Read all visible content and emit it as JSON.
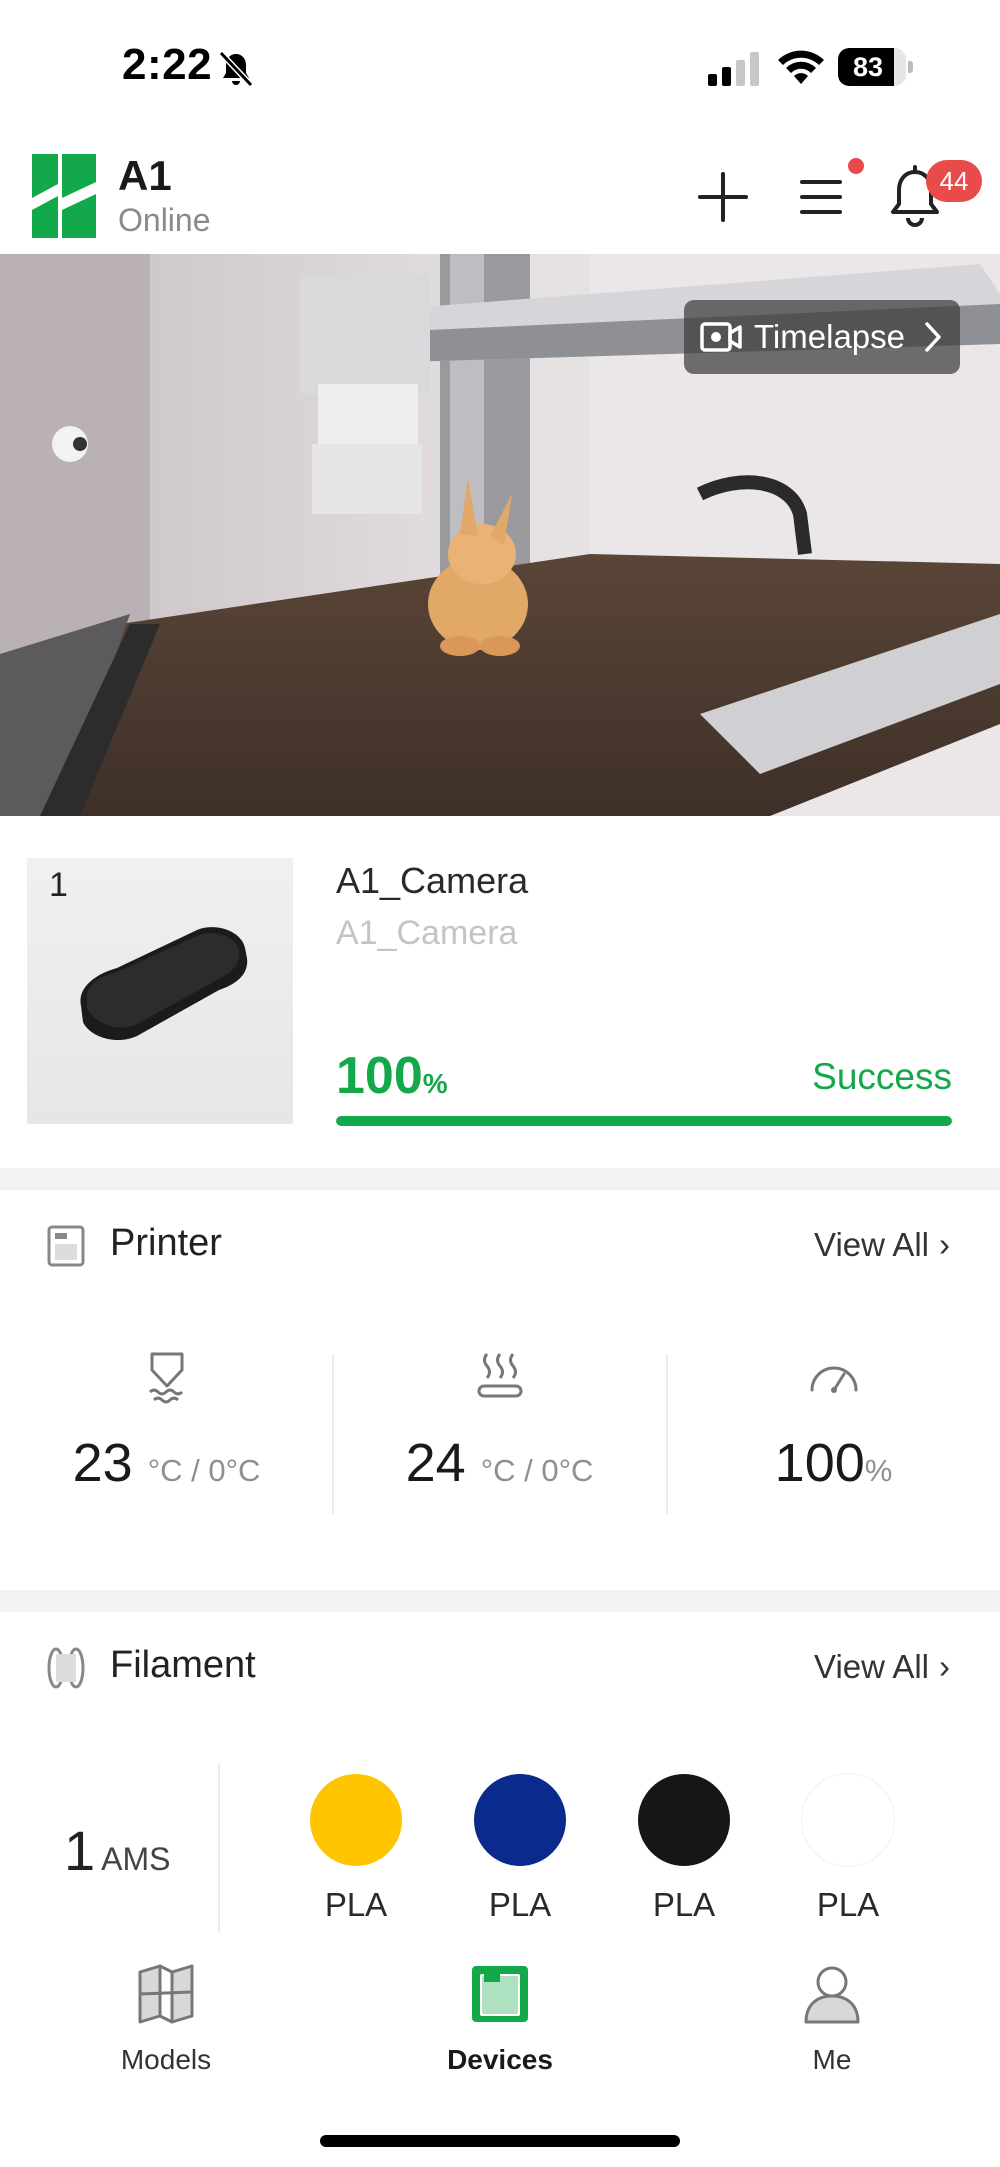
{
  "status_bar": {
    "time": "2:22",
    "battery": "83",
    "battery_level": 0.83
  },
  "header": {
    "device_name": "A1",
    "device_status": "Online",
    "notification_count": "44",
    "brand_color": "#13a84a"
  },
  "camera": {
    "timelapse_label": "Timelapse"
  },
  "job": {
    "plate_number": "1",
    "title": "A1_Camera",
    "subtitle": "A1_Camera",
    "progress_value": "100",
    "progress_unit": "%",
    "progress_fraction": 1.0,
    "state": "Success"
  },
  "printer": {
    "title": "Printer",
    "view_all": "View All",
    "nozzle": {
      "value": "23",
      "unit": "°C / 0°C"
    },
    "bed": {
      "value": "24",
      "unit": "°C / 0°C"
    },
    "speed": {
      "value": "100",
      "unit": "%"
    }
  },
  "filament": {
    "title": "Filament",
    "view_all": "View All",
    "ams_count": "1",
    "ams_label": "AMS",
    "slots": [
      {
        "type": "PLA",
        "color": "#ffc400"
      },
      {
        "type": "PLA",
        "color": "#0b2a8e"
      },
      {
        "type": "PLA",
        "color": "#161616"
      },
      {
        "type": "PLA",
        "color": "#ffffff"
      }
    ]
  },
  "nav": {
    "items": [
      {
        "label": "Models",
        "icon": "models-icon"
      },
      {
        "label": "Devices",
        "icon": "devices-icon",
        "active": true
      },
      {
        "label": "Me",
        "icon": "profile-icon"
      }
    ]
  }
}
